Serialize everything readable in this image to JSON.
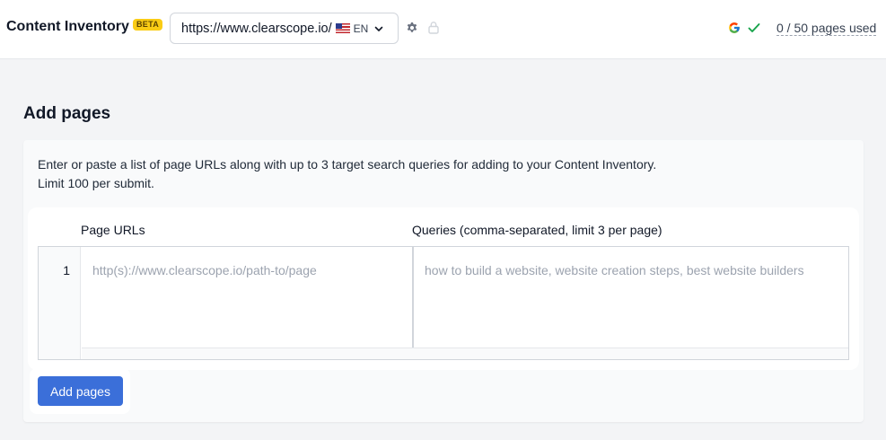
{
  "header": {
    "title": "Content Inventory",
    "badge": "BETA",
    "domain": "https://www.clearscope.io/",
    "language": "EN",
    "pages_used": "0 / 50 pages used"
  },
  "icons": {
    "flag": "us-flag-icon",
    "chevron": "chevron-down-icon",
    "settings": "gear-icon",
    "lock": "lock-icon",
    "google": "google-icon",
    "check": "check-icon"
  },
  "main": {
    "title": "Add pages",
    "instructions_line1": "Enter or paste a list of page URLs along with up to 3 target search queries for adding to your Content Inventory.",
    "instructions_line2": "Limit 100 per submit.",
    "grid": {
      "headers": [
        "Page URLs",
        "Queries (comma-separated, limit 3 per page)"
      ],
      "rows": [
        {
          "number": "1",
          "url_value": "",
          "url_placeholder": "http(s)://www.clearscope.io/path-to/page",
          "queries_value": "",
          "queries_placeholder": "how to build a website, website creation steps, best website builders"
        }
      ]
    },
    "submit_label": "Add pages"
  },
  "colors": {
    "accent": "#3b6fd9",
    "badge": "#facc15",
    "check": "#16a34a"
  }
}
